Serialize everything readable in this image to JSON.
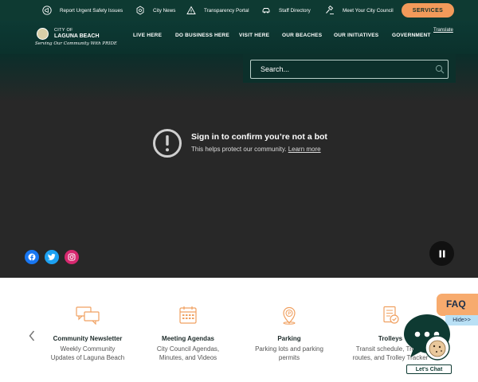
{
  "utility_bar": {
    "items": [
      {
        "label": "Report Urgent Safety Issues",
        "icon": "megaphone-icon"
      },
      {
        "label": "City News",
        "icon": "news-icon"
      },
      {
        "label": "Transparency Portal",
        "icon": "warning-icon"
      },
      {
        "label": "Staff Directory",
        "icon": "car-icon"
      },
      {
        "label": "Meet Your City Council",
        "icon": "gavel-icon"
      }
    ],
    "services_label": "SERVICES"
  },
  "header": {
    "logo_city": "CITY OF",
    "logo_name": "LAGUNA BEACH",
    "logo_tagline": "Serving Our Community With PRIDE",
    "nav": [
      "LIVE HERE",
      "DO BUSINESS HERE",
      "VISIT HERE",
      "OUR BEACHES",
      "OUR INITIATIVES",
      "GOVERNMENT"
    ],
    "translate_label": "Translate"
  },
  "search": {
    "placeholder": "Search..."
  },
  "video": {
    "title": "Sign in to confirm you’re not a bot",
    "subtitle": "This helps protect our community.",
    "link": "Learn more"
  },
  "social": [
    {
      "icon": "facebook-icon",
      "color": "#1877f2"
    },
    {
      "icon": "twitter-icon",
      "color": "#1da1f2"
    },
    {
      "icon": "instagram-icon",
      "color": "#d6286f"
    }
  ],
  "quick_links": [
    {
      "title": "Community Newsletter",
      "description": "Weekly Community Updates of Laguna Beach",
      "icon": "chat-bubbles-icon"
    },
    {
      "title": "Meeting Agendas",
      "description": "City Council Agendas, Minutes, and Videos",
      "icon": "calendar-icon"
    },
    {
      "title": "Parking",
      "description": "Parking lots and parking permits",
      "icon": "parking-pin-icon"
    },
    {
      "title": "Trolleys",
      "description": "Transit schedule, Trolley routes, and Trolley Tracker",
      "icon": "document-check-icon"
    }
  ],
  "faq": {
    "label": "FAQ",
    "hide_label": "Hide>>"
  },
  "chat": {
    "label": "Let's Chat"
  },
  "colors": {
    "header_bg": "#0e3a32",
    "accent": "#f29a5a",
    "icon_orange": "#f0a060"
  }
}
